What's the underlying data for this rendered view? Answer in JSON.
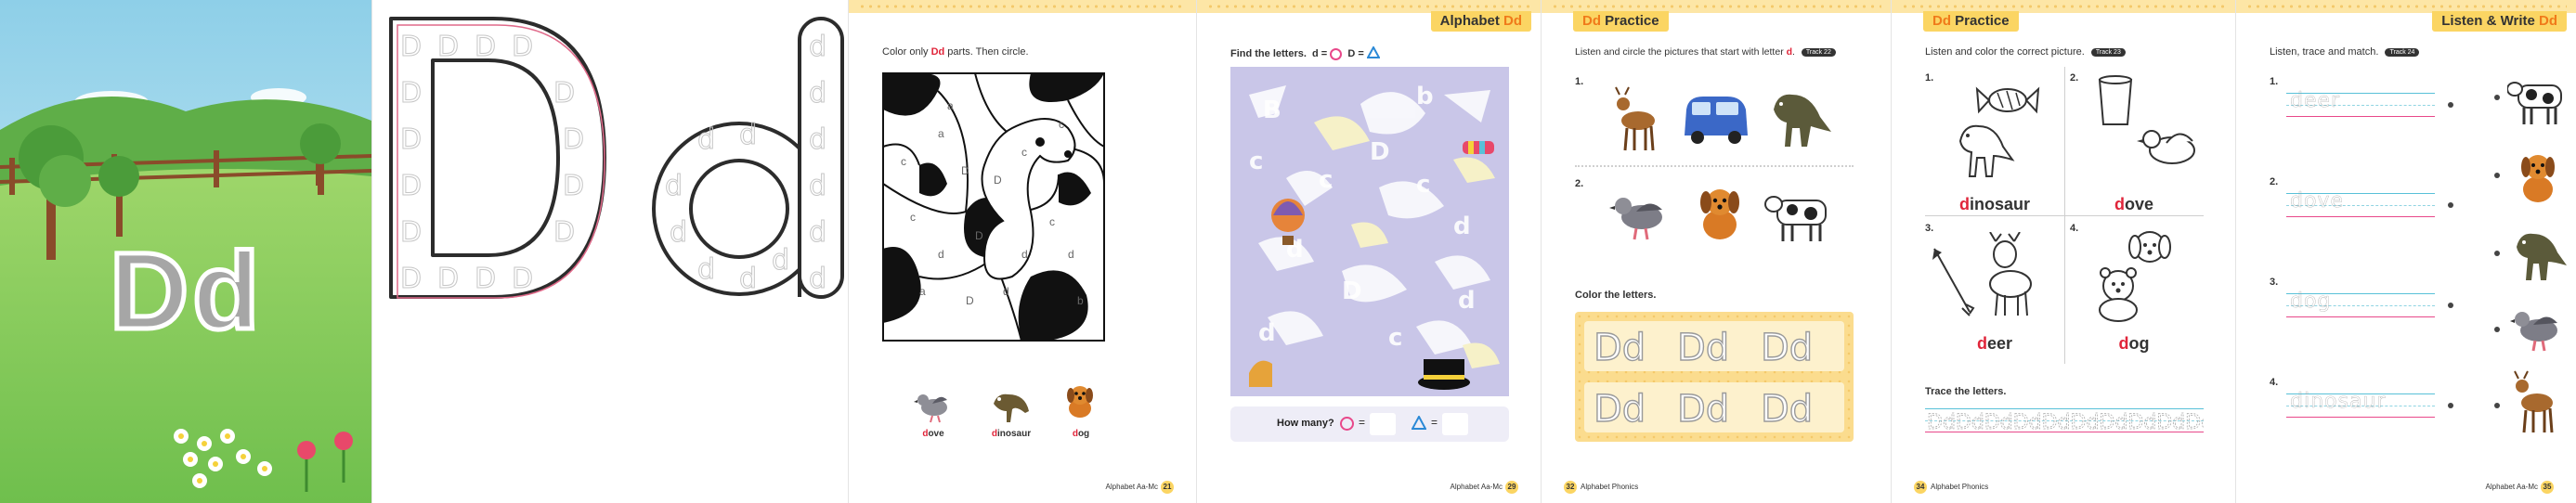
{
  "colors": {
    "accent": "#fbd563",
    "letter_red": "#e0253a",
    "sky": "#9fd5ea",
    "grass": "#8ccf5e",
    "purple_panel": "#c9c6e8"
  },
  "cover": {
    "letter": "Dd"
  },
  "big_letters": {
    "upper": "D",
    "lower": "d"
  },
  "page21": {
    "instruction_prefix": "Color only ",
    "instruction_letter": "Dd",
    "instruction_suffix": " parts. Then circle.",
    "words": [
      {
        "first": "d",
        "rest": "ove"
      },
      {
        "first": "d",
        "rest": "inosaur"
      },
      {
        "first": "d",
        "rest": "og"
      }
    ],
    "footer": "Alphabet Aa-Mc",
    "page_number": "21"
  },
  "page29": {
    "tag_prefix": "Alphabet ",
    "tag_letter": "Dd",
    "instruction": "Find the letters.",
    "legend_lower": "d =",
    "legend_upper": "D =",
    "how_many": "How many?",
    "footer": "Alphabet Aa-Mc",
    "page_number": "29"
  },
  "page32": {
    "tag_letter": "Dd",
    "tag_text": " Practice",
    "instruction": "Listen and circle the pictures that start with letter ",
    "instruction_letter": "d",
    "badge": "Track 22",
    "item1": "1.",
    "item2": "2.",
    "color_title": "Color the letters.",
    "footer": "Alphabet Phonics",
    "page_number": "32"
  },
  "page34": {
    "tag_letter": "Dd",
    "tag_text": " Practice",
    "instruction": "Listen and color the correct picture.",
    "badge": "Track 23",
    "items": [
      {
        "n": "1.",
        "first": "d",
        "rest": "inosaur"
      },
      {
        "n": "2.",
        "first": "d",
        "rest": "ove"
      },
      {
        "n": "3.",
        "first": "d",
        "rest": "eer"
      },
      {
        "n": "4.",
        "first": "d",
        "rest": "og"
      }
    ],
    "trace_title": "Trace the letters.",
    "footer": "Alphabet Phonics",
    "page_number": "34"
  },
  "page35": {
    "tag": "Listen & Write ",
    "tag_letter": "Dd",
    "instruction": "Listen, trace and match.",
    "badge": "Track 24",
    "rows": [
      {
        "n": "1.",
        "word": "deer"
      },
      {
        "n": "2.",
        "word": "dove"
      },
      {
        "n": "3.",
        "word": "dog"
      },
      {
        "n": "4.",
        "word": "dinosaur"
      }
    ],
    "footer": "Alphabet Aa-Mc",
    "page_number": "35"
  }
}
